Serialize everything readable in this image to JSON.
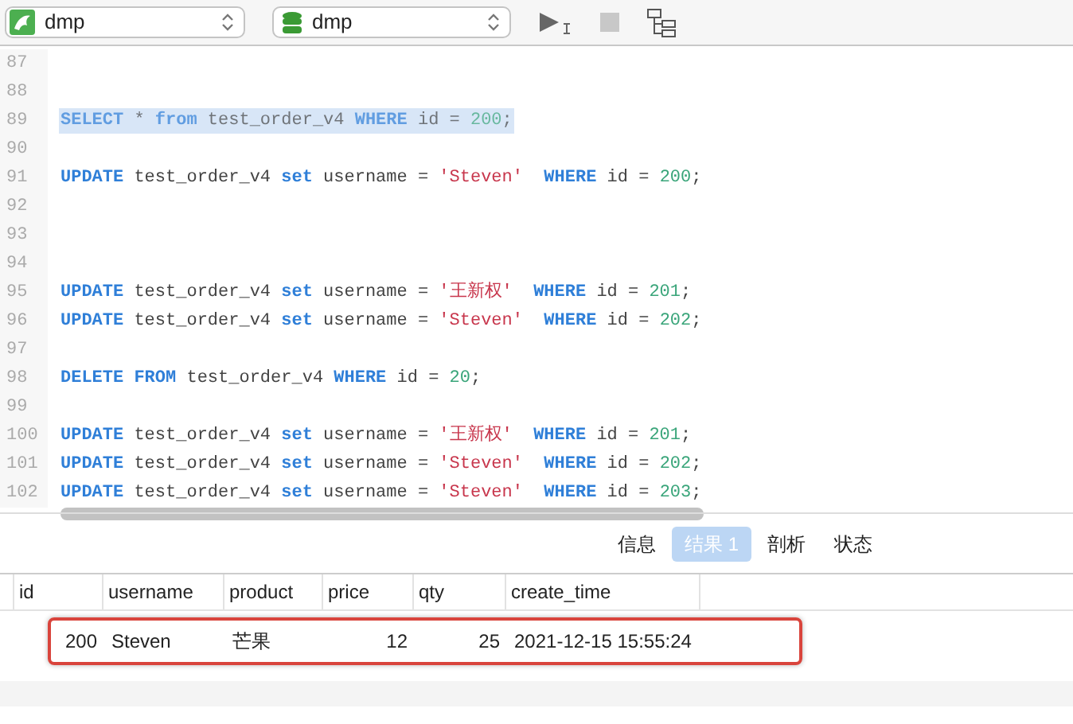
{
  "toolbar": {
    "connection": {
      "value": "dmp"
    },
    "database": {
      "value": "dmp"
    },
    "run_enabled": true,
    "stop_enabled": false
  },
  "editor": {
    "lines": [
      {
        "number": "87"
      },
      {
        "number": "88"
      },
      {
        "number": "89",
        "selected": true,
        "tokens": [
          {
            "kind": "keyword",
            "text": "SELECT"
          },
          {
            "kind": "plain",
            "text": " * "
          },
          {
            "kind": "keyword",
            "text": "from"
          },
          {
            "kind": "plain",
            "text": " test_order_v4 "
          },
          {
            "kind": "keyword",
            "text": "WHERE"
          },
          {
            "kind": "plain",
            "text": " id = "
          },
          {
            "kind": "number",
            "text": "200"
          },
          {
            "kind": "plain",
            "text": ";"
          }
        ]
      },
      {
        "number": "90"
      },
      {
        "number": "91",
        "selected": false,
        "tokens": [
          {
            "kind": "keyword",
            "text": "UPDATE"
          },
          {
            "kind": "plain",
            "text": " test_order_v4 "
          },
          {
            "kind": "keyword",
            "text": "set"
          },
          {
            "kind": "plain",
            "text": " username = "
          },
          {
            "kind": "string",
            "text": "'Steven'"
          },
          {
            "kind": "keyword",
            "text": "  WHERE"
          },
          {
            "kind": "plain",
            "text": " id = "
          },
          {
            "kind": "number",
            "text": "200"
          },
          {
            "kind": "plain",
            "text": ";"
          }
        ]
      },
      {
        "number": "92"
      },
      {
        "number": "93"
      },
      {
        "number": "94"
      },
      {
        "number": "95",
        "selected": false,
        "tokens": [
          {
            "kind": "keyword",
            "text": "UPDATE"
          },
          {
            "kind": "plain",
            "text": " test_order_v4 "
          },
          {
            "kind": "keyword",
            "text": "set"
          },
          {
            "kind": "plain",
            "text": " username = "
          },
          {
            "kind": "string",
            "text": "'王新权'"
          },
          {
            "kind": "keyword",
            "text": "  WHERE"
          },
          {
            "kind": "plain",
            "text": " id = "
          },
          {
            "kind": "number",
            "text": "201"
          },
          {
            "kind": "plain",
            "text": ";"
          }
        ]
      },
      {
        "number": "96",
        "selected": false,
        "tokens": [
          {
            "kind": "keyword",
            "text": "UPDATE"
          },
          {
            "kind": "plain",
            "text": " test_order_v4 "
          },
          {
            "kind": "keyword",
            "text": "set"
          },
          {
            "kind": "plain",
            "text": " username = "
          },
          {
            "kind": "string",
            "text": "'Steven'"
          },
          {
            "kind": "keyword",
            "text": "  WHERE"
          },
          {
            "kind": "plain",
            "text": " id = "
          },
          {
            "kind": "number",
            "text": "202"
          },
          {
            "kind": "plain",
            "text": ";"
          }
        ]
      },
      {
        "number": "97"
      },
      {
        "number": "98",
        "selected": false,
        "tokens": [
          {
            "kind": "keyword",
            "text": "DELETE FROM"
          },
          {
            "kind": "plain",
            "text": " test_order_v4 "
          },
          {
            "kind": "keyword",
            "text": "WHERE"
          },
          {
            "kind": "plain",
            "text": " id = "
          },
          {
            "kind": "number",
            "text": "20"
          },
          {
            "kind": "plain",
            "text": ";"
          }
        ]
      },
      {
        "number": "99"
      },
      {
        "number": "100",
        "selected": false,
        "tokens": [
          {
            "kind": "keyword",
            "text": "UPDATE"
          },
          {
            "kind": "plain",
            "text": " test_order_v4 "
          },
          {
            "kind": "keyword",
            "text": "set"
          },
          {
            "kind": "plain",
            "text": " username = "
          },
          {
            "kind": "string",
            "text": "'王新权'"
          },
          {
            "kind": "keyword",
            "text": "  WHERE"
          },
          {
            "kind": "plain",
            "text": " id = "
          },
          {
            "kind": "number",
            "text": "201"
          },
          {
            "kind": "plain",
            "text": ";"
          }
        ]
      },
      {
        "number": "101",
        "selected": false,
        "tokens": [
          {
            "kind": "keyword",
            "text": "UPDATE"
          },
          {
            "kind": "plain",
            "text": " test_order_v4 "
          },
          {
            "kind": "keyword",
            "text": "set"
          },
          {
            "kind": "plain",
            "text": " username = "
          },
          {
            "kind": "string",
            "text": "'Steven'"
          },
          {
            "kind": "keyword",
            "text": "  WHERE"
          },
          {
            "kind": "plain",
            "text": " id = "
          },
          {
            "kind": "number",
            "text": "202"
          },
          {
            "kind": "plain",
            "text": ";"
          }
        ]
      },
      {
        "number": "102",
        "selected": false,
        "tokens": [
          {
            "kind": "keyword",
            "text": "UPDATE"
          },
          {
            "kind": "plain",
            "text": " test_order_v4 "
          },
          {
            "kind": "keyword",
            "text": "set"
          },
          {
            "kind": "plain",
            "text": " username = "
          },
          {
            "kind": "string",
            "text": "'Steven'"
          },
          {
            "kind": "keyword",
            "text": "  WHERE"
          },
          {
            "kind": "plain",
            "text": " id = "
          },
          {
            "kind": "number",
            "text": "203"
          },
          {
            "kind": "plain",
            "text": ";"
          }
        ]
      }
    ]
  },
  "result_tabs": [
    {
      "label": "信息",
      "selected": false
    },
    {
      "label": "结果 1",
      "selected": true
    },
    {
      "label": "剖析",
      "selected": false
    },
    {
      "label": "状态",
      "selected": false
    }
  ],
  "table": {
    "columns": [
      {
        "label": "id",
        "numeric": true
      },
      {
        "label": "username",
        "numeric": false
      },
      {
        "label": "product",
        "numeric": false
      },
      {
        "label": "price",
        "numeric": true
      },
      {
        "label": "qty",
        "numeric": true
      },
      {
        "label": "create_time",
        "numeric": false
      }
    ],
    "rows": [
      {
        "outlined": true,
        "cells": [
          "200",
          "Steven",
          "芒果",
          "12",
          "25",
          "2021-12-15 15:55:24"
        ]
      }
    ]
  }
}
